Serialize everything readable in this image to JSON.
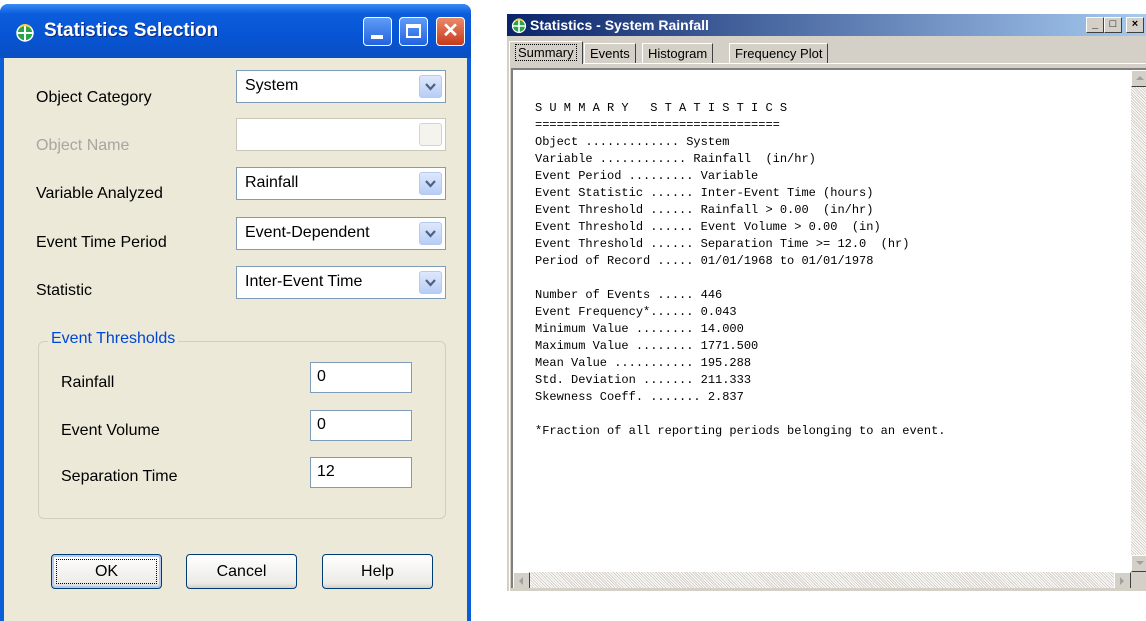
{
  "left_dialog": {
    "title": "Statistics Selection",
    "title_icon": "swmm-app-icon",
    "fields": {
      "object_category": {
        "label": "Object Category",
        "value": "System"
      },
      "object_name": {
        "label": "Object Name",
        "value": ""
      },
      "variable_analyzed": {
        "label": "Variable Analyzed",
        "value": "Rainfall"
      },
      "event_time_period": {
        "label": "Event Time Period",
        "value": "Event-Dependent"
      },
      "statistic": {
        "label": "Statistic",
        "value": "Inter-Event Time"
      }
    },
    "thresholds": {
      "legend": "Event Thresholds",
      "rainfall": {
        "label": "Rainfall",
        "value": "0"
      },
      "event_volume": {
        "label": "Event Volume",
        "value": "0"
      },
      "separation_time": {
        "label": "Separation Time",
        "value": "12"
      }
    },
    "buttons": {
      "ok": "OK",
      "cancel": "Cancel",
      "help": "Help"
    },
    "colors": {
      "titlebar": "#0054e3",
      "body": "#ece9d8",
      "group_legend": "#0046d5"
    }
  },
  "right_window": {
    "title": "Statistics - System Rainfall",
    "tabs": [
      "Summary",
      "Events",
      "Histogram",
      "Frequency Plot"
    ],
    "active_tab": "Summary",
    "summary": {
      "heading": "S U M M A R Y   S T A T I S T I C S",
      "rule": "==================================",
      "lines1": [
        "Object ............. System",
        "Variable ............ Rainfall  (in/hr)",
        "Event Period ......... Variable",
        "Event Statistic ...... Inter-Event Time (hours)",
        "Event Threshold ...... Rainfall > 0.00  (in/hr)",
        "Event Threshold ...... Event Volume > 0.00  (in)",
        "Event Threshold ...... Separation Time >= 12.0  (hr)",
        "Period of Record ..... 01/01/1968 to 01/01/1978"
      ],
      "lines2": [
        "Number of Events ..... 446",
        "Event Frequency*...... 0.043",
        "Minimum Value ........ 14.000",
        "Maximum Value ........ 1771.500",
        "Mean Value ........... 195.288",
        "Std. Deviation ....... 211.333",
        "Skewness Coeff. ....... 2.837"
      ],
      "footnote": "*Fraction of all reporting periods belonging to an event."
    },
    "colors": {
      "titlebar_start": "#0a246a",
      "titlebar_end": "#a6caf0",
      "face": "#d4d0c8"
    }
  }
}
